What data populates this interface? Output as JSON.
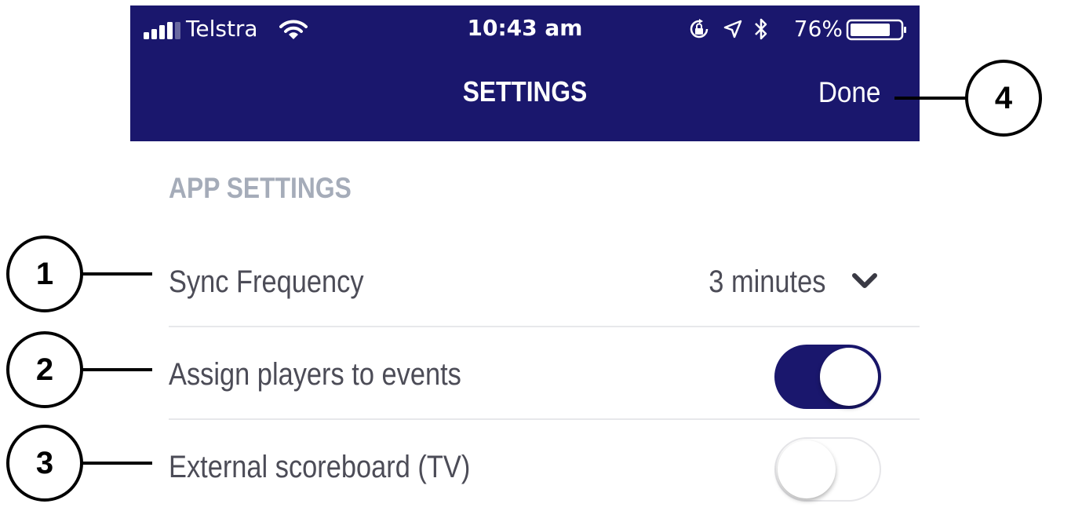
{
  "status_bar": {
    "carrier": "Telstra",
    "time": "10:43 am",
    "battery": "76%",
    "icons": [
      "signal-icon",
      "wifi-icon",
      "rotation-lock-icon",
      "location-icon",
      "bluetooth-icon",
      "battery-icon"
    ]
  },
  "nav": {
    "title": "SETTINGS",
    "done_label": "Done"
  },
  "section": {
    "header": "APP SETTINGS"
  },
  "rows": {
    "sync": {
      "label": "Sync Frequency",
      "value": "3 minutes"
    },
    "assign": {
      "label": "Assign players to events",
      "enabled": true
    },
    "scoreboard": {
      "label": "External scoreboard (TV)",
      "enabled": false
    }
  },
  "callouts": [
    "1",
    "2",
    "3",
    "4"
  ],
  "colors": {
    "nav_background": "#1a176d",
    "toggle_on": "#1a176d",
    "section_header": "#a5acb9",
    "row_text": "#4c4c57",
    "divider": "#e7e8eb"
  }
}
